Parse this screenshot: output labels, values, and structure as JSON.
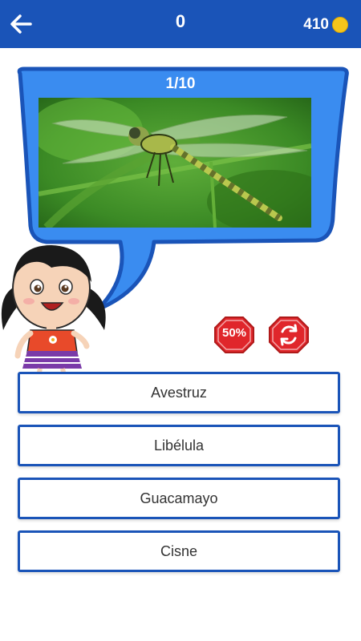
{
  "header": {
    "score": "0",
    "coins": "410"
  },
  "question": {
    "progress": "1/10",
    "image": "dragonfly-photo"
  },
  "powerups": {
    "fifty_label": "50%",
    "swap_icon": "refresh-icon"
  },
  "answers": [
    {
      "label": "Avestruz"
    },
    {
      "label": "Libélula"
    },
    {
      "label": "Guacamayo"
    },
    {
      "label": "Cisne"
    }
  ],
  "colors": {
    "primary": "#1a54b8",
    "bubble": "#3a8cf0",
    "powerup": "#e0262b",
    "coin": "#f5c51c"
  }
}
